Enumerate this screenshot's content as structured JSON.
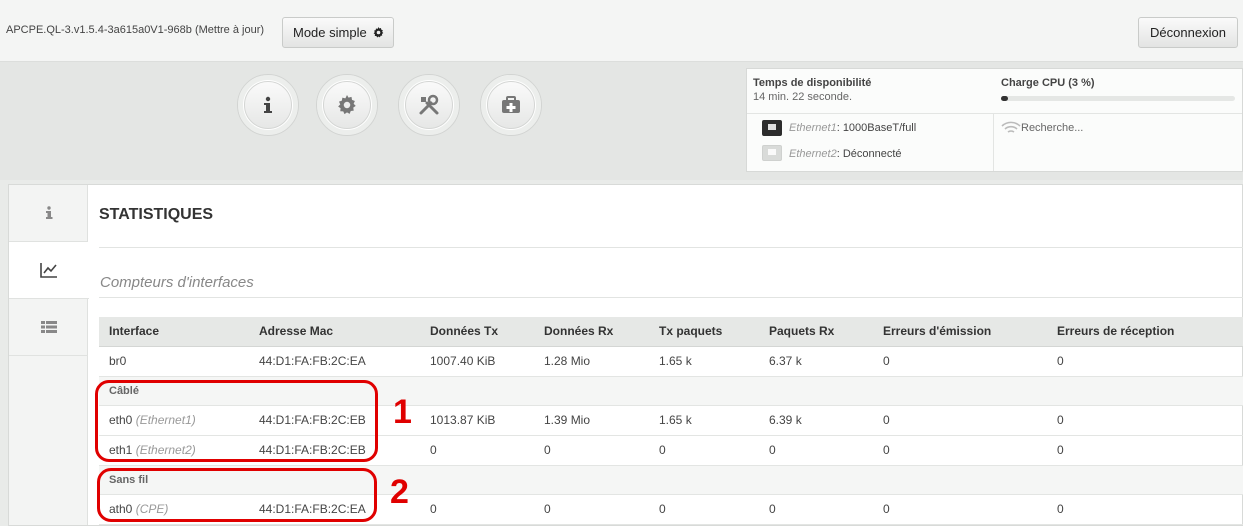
{
  "topbar": {
    "version": "APCPE.QL-3.v1.5.4-3a615a0V1-968b (Mettre à jour)",
    "mode_label": "Mode simple",
    "logout_label": "Déconnexion"
  },
  "nav_icons": [
    "info-icon",
    "gear-icon",
    "tools-icon",
    "first-aid-icon"
  ],
  "status": {
    "uptime_title": "Temps de disponibilité",
    "uptime_value": "14 min. 22 seconde.",
    "cpu_title": "Charge CPU (3 %)",
    "cpu_load": 0.03,
    "eth1_name": "Ethernet1",
    "eth1_state": ": 1000BaseT/full",
    "eth2_name": "Ethernet2",
    "eth2_state": ": Déconnecté",
    "wifi_state": "Recherche..."
  },
  "main": {
    "title": "STATISTIQUES",
    "subtitle": "Compteurs d'interfaces"
  },
  "table": {
    "headers": [
      "Interface",
      "Adresse Mac",
      "Données Tx",
      "Données Rx",
      "Tx paquets",
      "Paquets Rx",
      "Erreurs d'émission",
      "Erreurs de réception"
    ],
    "rows": [
      {
        "iface": "br0",
        "alias": "",
        "mac": "44:D1:FA:FB:2C:EA",
        "tx": "1007.40 KiB",
        "rx": "1.28 Mio",
        "txp": "1.65 k",
        "rxp": "6.37 k",
        "txe": "0",
        "rxe": "0"
      },
      {
        "iface": "eth0",
        "alias": "(Ethernet1)",
        "mac": "44:D1:FA:FB:2C:EB",
        "tx": "1013.87 KiB",
        "rx": "1.39 Mio",
        "txp": "1.65 k",
        "rxp": "6.39 k",
        "txe": "0",
        "rxe": "0"
      },
      {
        "iface": "eth1",
        "alias": "(Ethernet2)",
        "mac": "44:D1:FA:FB:2C:EB",
        "tx": "0",
        "rx": "0",
        "txp": "0",
        "rxp": "0",
        "txe": "0",
        "rxe": "0"
      },
      {
        "iface": "ath0",
        "alias": "(CPE)",
        "mac": "44:D1:FA:FB:2C:EA",
        "tx": "0",
        "rx": "0",
        "txp": "0",
        "rxp": "0",
        "txe": "0",
        "rxe": "0"
      }
    ],
    "group_wired": "Câblé",
    "group_wireless": "Sans fil"
  },
  "annotations": {
    "one": "1",
    "two": "2"
  },
  "colors": {
    "annotation": "#e00000",
    "active_port": "#2c2c2c"
  }
}
